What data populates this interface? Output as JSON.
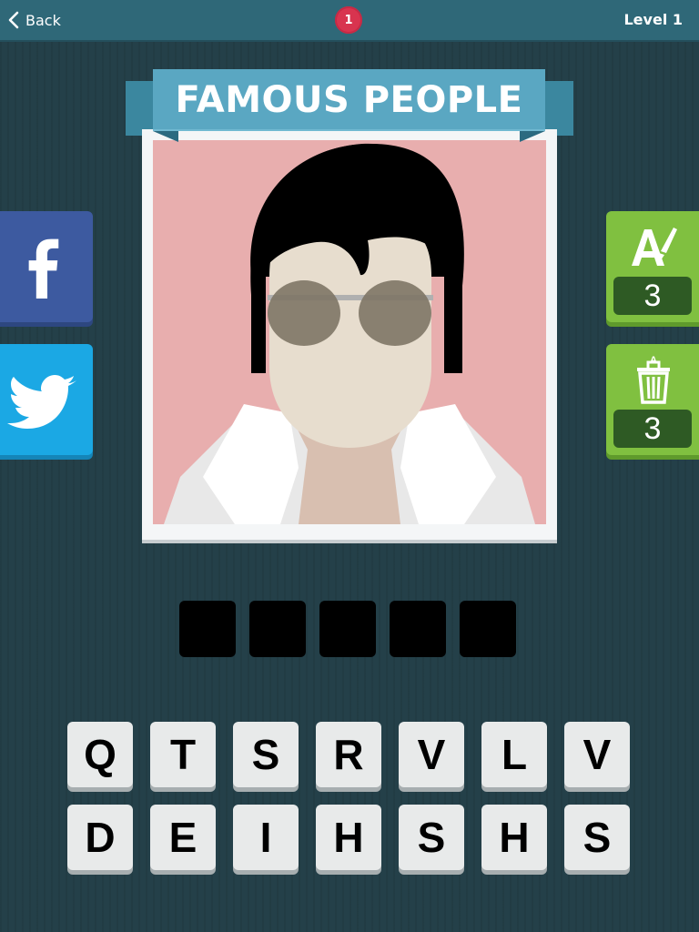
{
  "header": {
    "back_label": "Back",
    "badge_count": "1",
    "level_label": "Level 1"
  },
  "category": "FAMOUS PEOPLE",
  "social": [
    "facebook-icon",
    "twitter-icon"
  ],
  "hints": [
    {
      "icon": "reveal-letter-icon",
      "count": "3"
    },
    {
      "icon": "trash-letters-icon",
      "count": "3"
    }
  ],
  "answer_length": 5,
  "keyboard": {
    "row1": [
      "Q",
      "T",
      "S",
      "R",
      "V",
      "L",
      "V"
    ],
    "row2": [
      "D",
      "E",
      "I",
      "H",
      "S",
      "H",
      "S"
    ]
  },
  "colors": {
    "background": "#244049",
    "topbar": "#2f6878",
    "ribbon": "#5aa7c2",
    "badge": "#d8344f",
    "facebook": "#3d5aa0",
    "twitter": "#1ba8e4",
    "hint": "#80c040",
    "portrait_bg": "#e8aeae"
  }
}
